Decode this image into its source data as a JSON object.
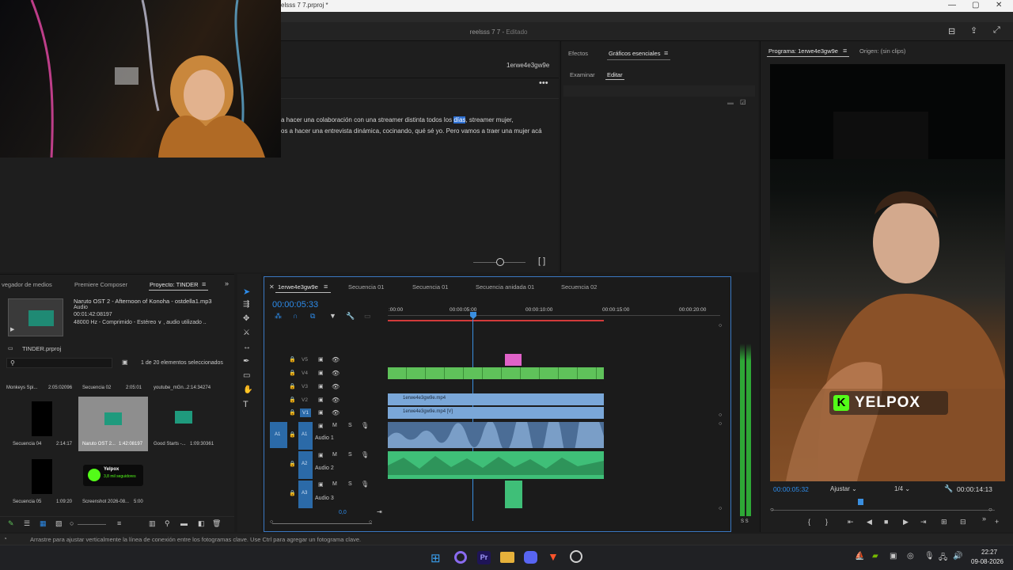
{
  "window": {
    "title": "elsss 7 7.prproj *",
    "project_name": "reelsss 7 7",
    "edited_state": "Editado"
  },
  "transcript": {
    "speaker": "1erwe4e3gw9e",
    "line1_pre": "a hacer una colaboración con una streamer distinta todos los ",
    "line1_hl": "días",
    "line1_post": ", streamer mujer,",
    "line2": "os a hacer una entrevista dinámica, cocinando, qué sé yo. Pero vamos a traer una mujer acá"
  },
  "effects_panel": {
    "tabs": [
      "Efectos",
      "Gráficos esenciales"
    ],
    "subtabs": [
      "Examinar",
      "Editar"
    ]
  },
  "program_monitor": {
    "tabs": [
      "Programa: 1erwe4e3gw9e",
      "Origen: (sin clips)"
    ],
    "overlay_text": "YELPOX",
    "timecode": "00:00:05:32",
    "fit": "Ajustar",
    "resolution": "1/4",
    "duration": "00:00:14:13"
  },
  "project_panel": {
    "tabs": [
      "vegador de medios",
      "Premiere Composer",
      "Proyecto: TINDER"
    ],
    "selected_name": "Naruto OST 2 - Afternoon of Konoha - ostdella1.mp3",
    "selected_type": "Audio",
    "selected_duration": "00:01:42:08197",
    "selected_info": "48000 Hz - Comprimido - Estéreo  ∨  , audio utilizado ..",
    "file": "TINDER.prproj",
    "selection_count": "1 de 20 elementos seleccionados",
    "top_row": [
      {
        "name": "Monkeys Spi...",
        "dur": "2:05:02096"
      },
      {
        "name": "Secuencia 02",
        "dur": "2:05:01"
      },
      {
        "name": "youtube_mGn...",
        "dur": "2:14:34274"
      }
    ],
    "items": [
      {
        "name": "Secuencia 04",
        "dur": "2:14:17"
      },
      {
        "name": "Naruto OST 2...",
        "dur": "1:42:08197"
      },
      {
        "name": "Good Starts -...",
        "dur": "1:09:30361"
      },
      {
        "name": "Secuencia 05",
        "dur": "1:09:20"
      },
      {
        "name": "Screenshot 2026-08...",
        "dur": "5:00"
      }
    ],
    "card_name": "Yelpox",
    "card_sub": "3,8 mil seguidores"
  },
  "timeline": {
    "tabs": [
      "1erwe4e3gw9e",
      "Secuencia 01",
      "Secuencia 01",
      "Secuencia anidada 01",
      "Secuencia 02"
    ],
    "timecode": "00:00:05:33",
    "ruler": [
      ":00:00",
      "00:00:05:00",
      "00:00:10:00",
      "00:00:15:00",
      "00:00:20:00"
    ],
    "video_tracks": [
      "V5",
      "V4",
      "V3",
      "V2",
      "V1"
    ],
    "audio_tracks": [
      {
        "id": "A1",
        "name": "Audio 1"
      },
      {
        "id": "A2",
        "name": "Audio 2"
      },
      {
        "id": "A3",
        "name": "Audio 3"
      }
    ],
    "clip_v2": "1erwe4e3gw9e.mp4",
    "clip_v1": "1erwe4e3gw9e.mp4 [V]",
    "zoom": "0,0"
  },
  "statusbar": {
    "text": "Arrastre para ajustar verticalmente la línea de conexión entre los fotogramas clave. Use Ctrl para agregar un fotograma clave."
  },
  "taskbar": {
    "time": "22:27",
    "date": "09-08-2026"
  },
  "colors": {
    "accent": "#2d8ceb",
    "clip_green": "#5fc25a",
    "clip_blue": "#7aa7d8",
    "audio_green": "#3fbf78",
    "playhead": "#3a8fe0"
  }
}
